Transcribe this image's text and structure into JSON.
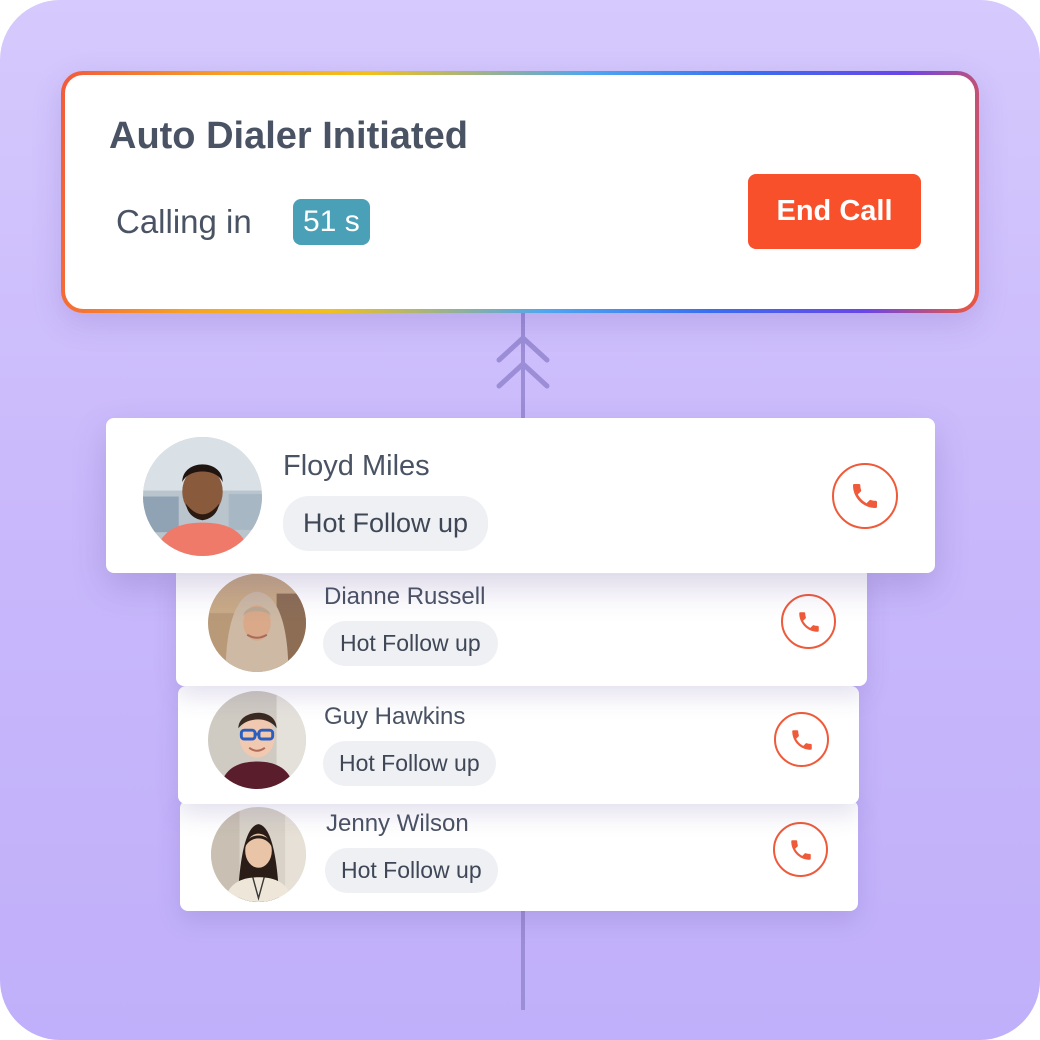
{
  "dialer": {
    "title": "Auto Dialer Initiated",
    "calling_label": "Calling in",
    "countdown": "51 s",
    "end_call_label": "End Call"
  },
  "contacts": [
    {
      "name": "Floyd Miles",
      "tag": "Hot Follow up"
    },
    {
      "name": "Dianne Russell",
      "tag": "Hot Follow up"
    },
    {
      "name": "Guy Hawkins",
      "tag": "Hot Follow up"
    },
    {
      "name": "Jenny Wilson",
      "tag": "Hot Follow up"
    }
  ],
  "colors": {
    "accent": "#f8502b",
    "countdown_badge": "#4aa0b6",
    "text": "#4a5364",
    "background": "#c9b8fb"
  },
  "icons": {
    "call": "phone-icon",
    "connector": "double-chevron-up-icon"
  }
}
